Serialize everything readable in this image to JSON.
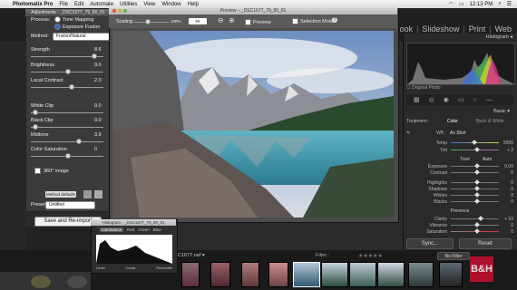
{
  "menubar": {
    "app": "Photomatix Pro",
    "items": [
      "File",
      "Edit",
      "Automate",
      "Utilities",
      "View",
      "Window",
      "Help"
    ],
    "clock": "12:13 PM"
  },
  "modules": {
    "items": [
      "ook",
      "Slideshow",
      "Print",
      "Web"
    ]
  },
  "adjustments": {
    "title": "Adjustments - _DSC1677_79_80_81",
    "process_label": "Process:",
    "process_options": [
      "Tone Mapping",
      "Exposure Fusion"
    ],
    "method_label": "Method:",
    "method_value": "Fusion/Natural",
    "sliders": [
      {
        "label": "Strength",
        "value": "8.6",
        "level": 0.86
      },
      {
        "label": "Brightness",
        "value": "0.0",
        "level": 0.5
      },
      {
        "label": "Local Contrast",
        "value": "2.0",
        "level": 0.55
      },
      {
        "label": "White Clip",
        "value": "0.0",
        "level": 0.05
      },
      {
        "label": "Black Clip",
        "value": "0.0",
        "level": 0.05
      },
      {
        "label": "Midtone",
        "value": "3.9",
        "level": 0.6
      },
      {
        "label": "Color Saturation",
        "value": "0",
        "level": 0.5
      }
    ],
    "checkbox_360": "360° image",
    "method_defaults": "Method defaults",
    "preset_label": "Preset:",
    "preset_value": "Untitled",
    "save_button": "Save and Re-import"
  },
  "preview": {
    "title": "Preview – _DSC1677_79_80_81",
    "scaling_label": "Scaling:",
    "scaling_value": "100%",
    "fit_label": "Fit",
    "preview_label": "Preview",
    "selection_mode": "Selection Mode"
  },
  "histogram_win": {
    "title": "Histogram - _DSC1677_79_80_81",
    "tabs": [
      "Luminance",
      "Red",
      "Green",
      "Blue"
    ],
    "footer": [
      "Level",
      "Count",
      "Percentile"
    ]
  },
  "lr_right": {
    "histogram_title": "Histogram",
    "original_photo": "Original Photo",
    "basic_title": "Basic",
    "treatment_label": "Treatment :",
    "treatment_color": "Color",
    "treatment_bw": "Black & White",
    "wb_label": "WB :",
    "wb_value": "As Shot",
    "temp_rows": [
      {
        "label": "Temp",
        "value": "5050"
      },
      {
        "label": "Tint",
        "value": "+ 2"
      }
    ],
    "tone_label": "Tone",
    "tone_auto": "Auto",
    "tone_rows": [
      {
        "label": "Exposure",
        "value": "0.00"
      },
      {
        "label": "Contrast",
        "value": "0"
      },
      {
        "label": "Highlights",
        "value": "0"
      },
      {
        "label": "Shadows",
        "value": "0"
      },
      {
        "label": "Whites",
        "value": "0"
      },
      {
        "label": "Blacks",
        "value": "0"
      }
    ],
    "presence_label": "Presence",
    "presence_rows": [
      {
        "label": "Clarity",
        "value": "+ 10"
      },
      {
        "label": "Vibrance",
        "value": "0"
      },
      {
        "label": "Saturation",
        "value": "0"
      }
    ],
    "sync_button": "Sync...",
    "reset_button": "Reset"
  },
  "filmstrip": {
    "filename": "C1677.nef ▾",
    "filter_label": "Filter :",
    "filter_value": "No Filter"
  },
  "watermark": "B&H",
  "colors": {
    "accent": "#2d6bd1",
    "bh_red": "#c8102e"
  }
}
